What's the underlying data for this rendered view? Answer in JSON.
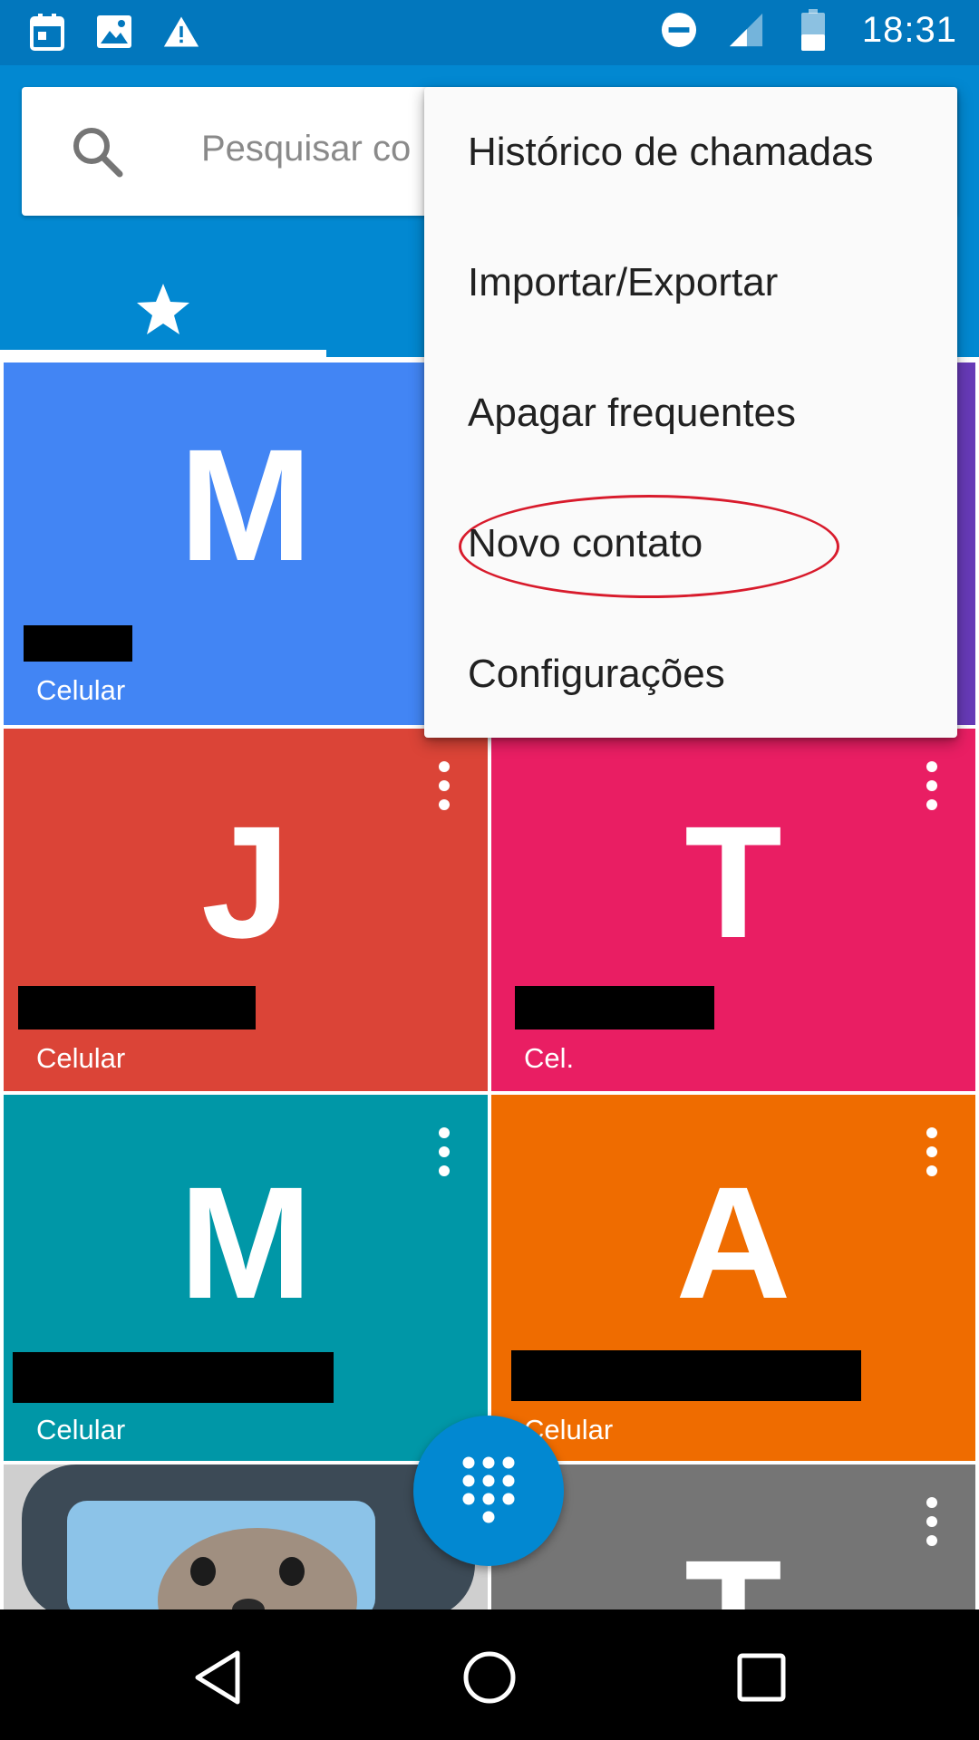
{
  "status_bar": {
    "time": "18:31",
    "left_icons": [
      "calendar-icon",
      "image-icon",
      "warning-icon"
    ],
    "right_icons": [
      "do-not-disturb-icon",
      "signal-icon",
      "battery-icon"
    ]
  },
  "search": {
    "placeholder": "Pesquisar co"
  },
  "tabs": [
    {
      "icon": "star-icon",
      "selected": true
    }
  ],
  "menu": {
    "items": [
      {
        "label": "Histórico de chamadas"
      },
      {
        "label": "Importar/Exportar"
      },
      {
        "label": "Apagar frequentes"
      },
      {
        "label": "Novo contato",
        "highlighted": true
      },
      {
        "label": "Configurações"
      }
    ]
  },
  "contacts": [
    {
      "letter": "M",
      "type": "Celular",
      "color": "#4285f4"
    },
    {
      "letter": "",
      "type": "",
      "color": "#673ab7"
    },
    {
      "letter": "J",
      "type": "Celular",
      "color": "#db4437"
    },
    {
      "letter": "T",
      "type": "Cel.",
      "color": "#e91e63"
    },
    {
      "letter": "M",
      "type": "Celular",
      "color": "#0097a7"
    },
    {
      "letter": "A",
      "type": "Celular",
      "color": "#ef6c00"
    },
    {
      "letter": "",
      "type": "",
      "color": "#d8d8d8"
    },
    {
      "letter": "T",
      "type": "",
      "color": "#757575"
    }
  ],
  "colors": {
    "status_bar": "#0277bd",
    "app_bar": "#0288d1",
    "fab": "#0288d1",
    "highlight_ring": "#d81b2c"
  }
}
